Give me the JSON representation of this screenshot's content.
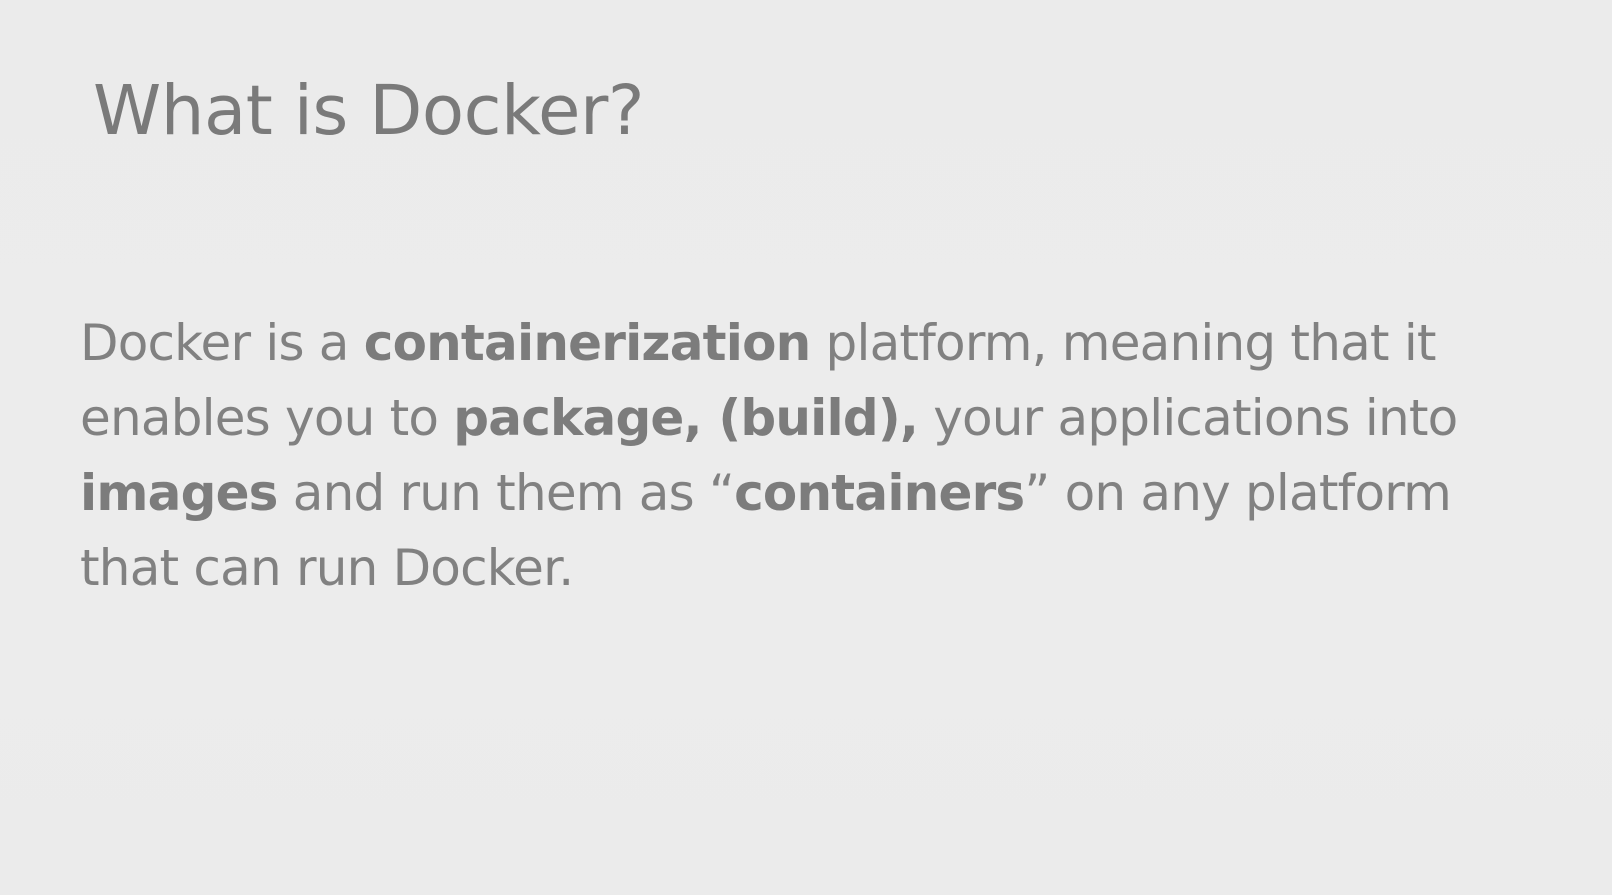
{
  "slide": {
    "title": "What is Docker?",
    "body_lines": [
      [
        {
          "text": "Docker is a ",
          "bold": false
        },
        {
          "text": "containerization",
          "bold": true
        },
        {
          "text": " platform, meaning that it",
          "bold": false
        }
      ],
      [
        {
          "text": "enables you to ",
          "bold": false
        },
        {
          "text": "package, (build),",
          "bold": true
        },
        {
          "text": " your applications into",
          "bold": false
        }
      ],
      [
        {
          "text": "images",
          "bold": true
        },
        {
          "text": " and run them as “",
          "bold": false
        },
        {
          "text": "containers",
          "bold": true
        },
        {
          "text": "” on any platform",
          "bold": false
        }
      ],
      [
        {
          "text": "that can run Docker.",
          "bold": false
        }
      ]
    ],
    "colors": {
      "background": "#ebebeb",
      "title_text": "#7a7a7a",
      "body_text": "#818181",
      "bold_text": "#7c7c7c"
    }
  }
}
